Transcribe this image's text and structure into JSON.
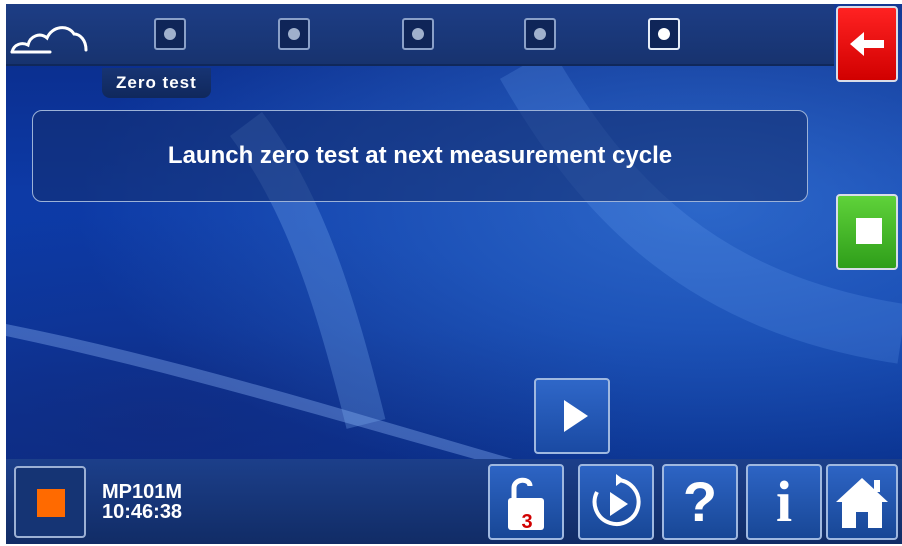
{
  "screen": {
    "title": "Zero test",
    "message": "Launch zero test at next measurement cycle"
  },
  "header": {
    "logo": "cloud-icon",
    "step_indicators": [
      {
        "state": "inactive"
      },
      {
        "state": "inactive"
      },
      {
        "state": "inactive"
      },
      {
        "state": "inactive"
      },
      {
        "state": "active"
      }
    ]
  },
  "side_buttons": {
    "back": {
      "icon": "arrow-left-icon",
      "color": "#e00000"
    },
    "stop": {
      "icon": "stop-icon",
      "color": "#3cb521"
    }
  },
  "action": {
    "play": {
      "icon": "play-icon"
    }
  },
  "status": {
    "indicator_color": "#ff6a00",
    "device_name": "MP101M",
    "time": "10:46:38"
  },
  "bottom_toolbar": {
    "lock": {
      "icon": "unlock-icon",
      "level": "3"
    },
    "cycle": {
      "icon": "cycle-play-icon"
    },
    "help": {
      "icon": "help-icon",
      "glyph": "?"
    },
    "info": {
      "icon": "info-icon",
      "glyph": "i"
    },
    "home": {
      "icon": "home-icon"
    }
  }
}
